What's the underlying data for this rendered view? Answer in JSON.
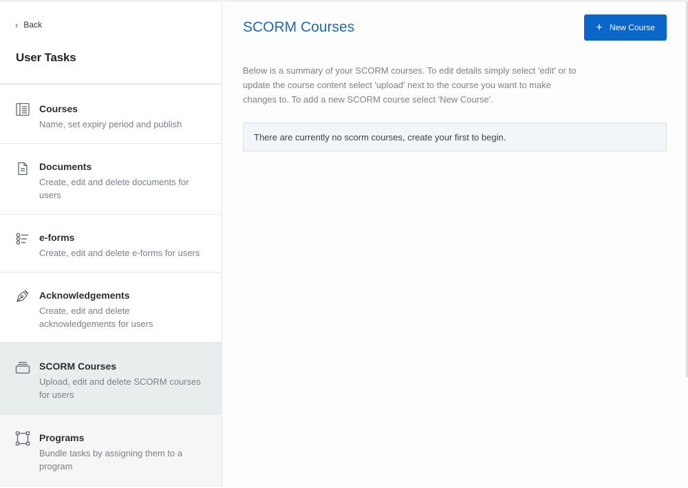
{
  "sidebar": {
    "back_label": "Back",
    "title": "User Tasks",
    "items": [
      {
        "title": "Courses",
        "desc": "Name, set expiry period and publish",
        "icon": "book-icon"
      },
      {
        "title": "Documents",
        "desc": "Create, edit and delete documents for users",
        "icon": "document-icon"
      },
      {
        "title": "e-forms",
        "desc": "Create, edit and delete e-forms for users",
        "icon": "checklist-icon"
      },
      {
        "title": "Acknowledgements",
        "desc": "Create, edit and delete acknowledgements for users",
        "icon": "pen-nib-icon"
      },
      {
        "title": "SCORM Courses",
        "desc": "Upload, edit and delete SCORM courses for users",
        "icon": "stack-icon"
      },
      {
        "title": "Programs",
        "desc": "Bundle tasks by assigning them to a program",
        "icon": "frame-icon"
      }
    ]
  },
  "main": {
    "title": "SCORM Courses",
    "new_button_label": "New Course",
    "summary": "Below is a summary of your SCORM courses. To edit details simply select 'edit' or to update the course content select 'upload' next to the course you want to make changes to. To add a new SCORM course select 'New Course'.",
    "empty_notice": "There are currently no scorm courses, create your first to begin."
  },
  "colors": {
    "accent": "#0a66c8",
    "title_blue": "#1d6ab8",
    "active_item_bg": "#e8eeee"
  }
}
